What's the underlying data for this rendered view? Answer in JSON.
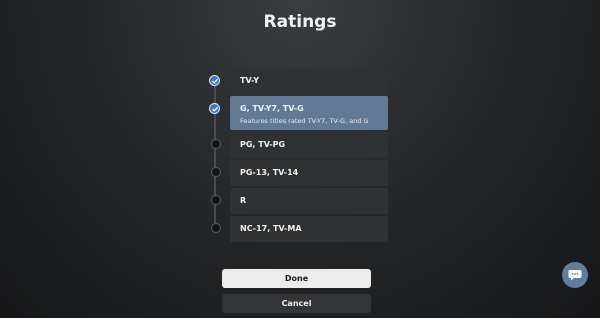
{
  "page": {
    "title": "Ratings"
  },
  "ratings": [
    {
      "label": "TV-Y",
      "checked": true,
      "selected": false,
      "description": ""
    },
    {
      "label": "G, TV-Y7, TV-G",
      "checked": true,
      "selected": true,
      "description": "Features titles rated TV-Y7, TV-G, and G"
    },
    {
      "label": "PG, TV-PG",
      "checked": false,
      "selected": false,
      "description": ""
    },
    {
      "label": "PG-13, TV-14",
      "checked": false,
      "selected": false,
      "description": ""
    },
    {
      "label": "R",
      "checked": false,
      "selected": false,
      "description": ""
    },
    {
      "label": "NC-17, TV-MA",
      "checked": false,
      "selected": false,
      "description": ""
    }
  ],
  "buttons": {
    "done": "Done",
    "cancel": "Cancel"
  },
  "colors": {
    "selected_row": "#607a96",
    "check": "#3c78c0",
    "chat_button": "#5f7e9e"
  },
  "icons": {
    "check": "check-icon",
    "chat": "chat-bubble-icon"
  }
}
